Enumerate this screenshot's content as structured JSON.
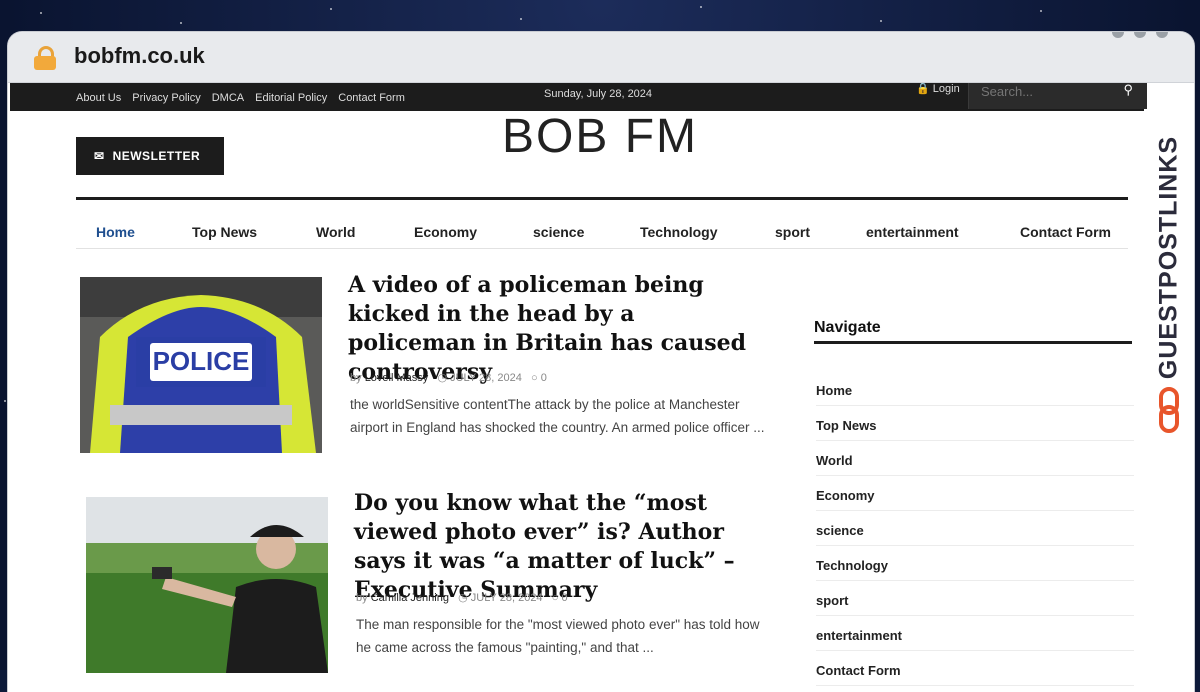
{
  "browser": {
    "url": "bobfm.co.uk"
  },
  "topbar": {
    "links": [
      "About Us",
      "Privacy Policy",
      "DMCA",
      "Editorial Policy",
      "Contact Form"
    ],
    "date": "Sunday, July 28, 2024",
    "login": "Login",
    "search_placeholder": "Search..."
  },
  "header": {
    "newsletter_label": "NEWSLETTER",
    "logo": "BOB FM"
  },
  "nav": {
    "items": [
      "Home",
      "Top News",
      "World",
      "Economy",
      "science",
      "Technology",
      "sport",
      "entertainment",
      "Contact Form"
    ],
    "active": "Home"
  },
  "articles": [
    {
      "title": "A video of a policeman being kicked in the head by a policeman in Britain has caused controversy",
      "by": "by",
      "author": "Lovell Massy",
      "date": "JULY 28, 2024",
      "comments": "0",
      "excerpt": "the worldSensitive contentThe attack by the police at Manchester airport in England has shocked the country. An armed police officer ...",
      "image_text": "POLICE"
    },
    {
      "title": "Do you know what the “most viewed photo ever” is? Author says it was “a matter of luck” – Executive Summary",
      "by": "by",
      "author": "Camilla Jenning",
      "date": "JULY 28, 2024",
      "comments": "0",
      "excerpt": "The man responsible for the \"most viewed photo ever\" has told how he came across the famous \"painting,\" and that ..."
    }
  ],
  "sidebar": {
    "title": "Navigate",
    "items": [
      "Home",
      "Top News",
      "World",
      "Economy",
      "science",
      "Technology",
      "sport",
      "entertainment",
      "Contact Form"
    ]
  },
  "watermark": {
    "text": "GUESTPOSTLINKS"
  },
  "colors": {
    "accent": "#1f4f8f",
    "dark": "#1c1c1c",
    "lock": "#f2a93b",
    "watermark_orange": "#e8552b"
  }
}
